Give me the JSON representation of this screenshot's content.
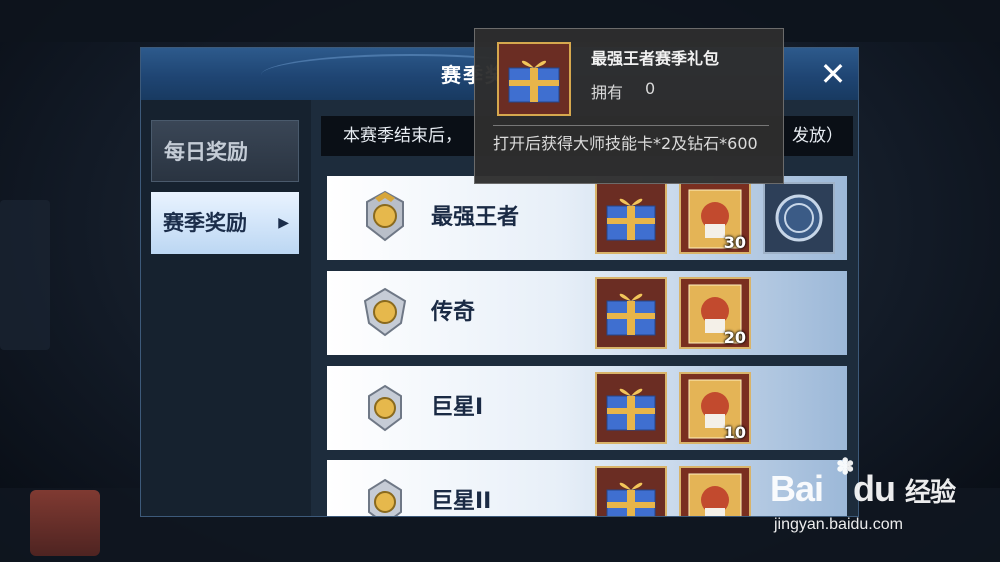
{
  "panel": {
    "title": "赛季奖励",
    "close_icon": "close-icon"
  },
  "sidebar": {
    "tabs": [
      {
        "label": "每日奖励",
        "active": false
      },
      {
        "label": "赛季奖励",
        "active": true
      }
    ]
  },
  "notice": {
    "start": "本赛季结束后，",
    "end": "发放）"
  },
  "rows": [
    {
      "rank": "最强王者",
      "rewards": [
        {
          "type": "gift-box-icon"
        },
        {
          "type": "skill-card-icon",
          "count": "30"
        },
        {
          "type": "badge-icon"
        }
      ]
    },
    {
      "rank": "传奇",
      "rewards": [
        {
          "type": "gift-box-icon"
        },
        {
          "type": "skill-card-icon",
          "count": "20"
        }
      ]
    },
    {
      "rank": "巨星I",
      "rewards": [
        {
          "type": "gift-box-icon"
        },
        {
          "type": "skill-card-icon",
          "count": "10"
        }
      ]
    },
    {
      "rank": "巨星II",
      "rewards": [
        {
          "type": "gift-box-icon"
        },
        {
          "type": "skill-card-icon"
        }
      ]
    }
  ],
  "tooltip": {
    "item_name": "最强王者赛季礼包",
    "own_label": "拥有",
    "own_value": "0",
    "description": "打开后获得大师技能卡*2及钻石*600"
  },
  "watermark": {
    "logo": "Bai",
    "logo_cn": "经验",
    "url": "jingyan.baidu.com"
  },
  "colors": {
    "header_blue": "#1f4573",
    "row_white": "#ffffff",
    "gift_blue": "#3f6fd0",
    "ribbon_gold": "#e8b54a"
  }
}
